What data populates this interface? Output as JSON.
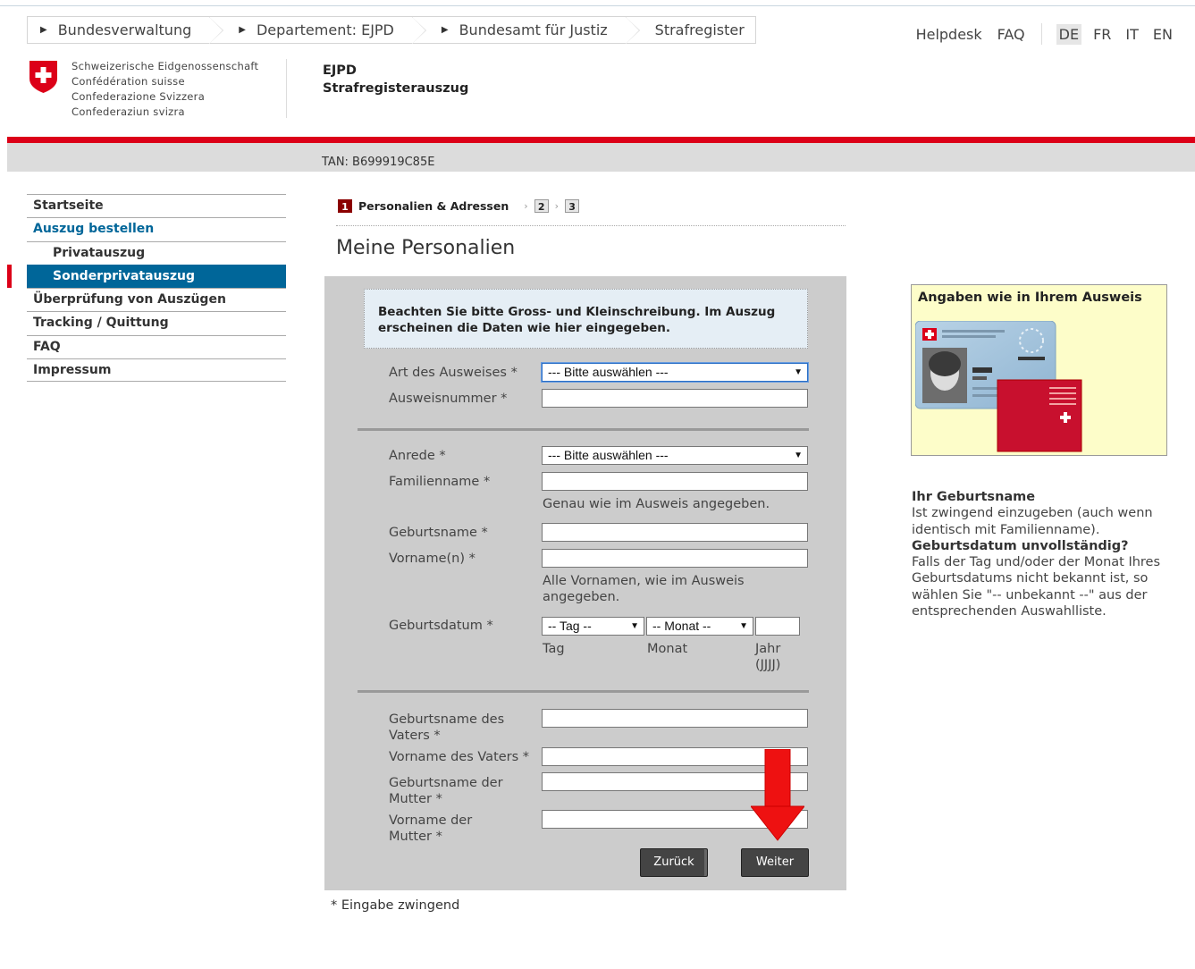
{
  "breadcrumb": [
    {
      "label": "Bundesverwaltung"
    },
    {
      "label": "Departement: EJPD"
    },
    {
      "label": "Bundesamt für Justiz"
    },
    {
      "label": "Strafregister"
    }
  ],
  "toplinks": {
    "helpdesk": "Helpdesk",
    "faq": "FAQ"
  },
  "languages": [
    "DE",
    "FR",
    "IT",
    "EN"
  ],
  "active_language": "DE",
  "confederation": [
    "Schweizerische Eidgenossenschaft",
    "Confédération suisse",
    "Confederazione Svizzera",
    "Confederaziun svizra"
  ],
  "department": {
    "short": "EJPD",
    "title": "Strafregisterauszug"
  },
  "tan": "TAN: B699919C85E",
  "nav": [
    {
      "label": "Startseite"
    },
    {
      "label": "Auszug bestellen"
    },
    {
      "label": "Privatauszug"
    },
    {
      "label": "Sonderprivatauszug"
    },
    {
      "label": "Überprüfung von Auszügen"
    },
    {
      "label": "Tracking / Quittung"
    },
    {
      "label": "FAQ"
    },
    {
      "label": "Impressum"
    }
  ],
  "steps": {
    "step1_num": "1",
    "step1_label": "Personalien & Adressen",
    "step2_num": "2",
    "step3_num": "3"
  },
  "page_title": "Meine Personalien",
  "notice": "Beachten Sie bitte Gross- und Kleinschreibung. Im Auszug erscheinen die Daten wie hier eingegeben.",
  "form": {
    "id_type_label": "Art des Ausweises *",
    "id_type_value": "--- Bitte auswählen ---",
    "id_number_label": "Ausweisnummer *",
    "salutation_label": "Anrede *",
    "salutation_value": "--- Bitte auswählen ---",
    "family_name_label": "Familienname *",
    "family_name_hint": "Genau wie im Ausweis angegeben.",
    "birth_name_label": "Geburtsname *",
    "first_names_label": "Vorname(n) *",
    "first_names_hint": "Alle Vornamen, wie im Ausweis angegeben.",
    "birthdate_label": "Geburtsdatum  *",
    "day_value": "-- Tag --",
    "month_value": "-- Monat --",
    "day_hint": "Tag",
    "month_hint": "Monat",
    "year_hint": "Jahr (JJJJ)",
    "father_birth_name_label": "Geburtsname des Vaters *",
    "father_first_name_label": "Vorname des Vaters *",
    "mother_birth_name_label": "Geburtsname der Mutter *",
    "mother_first_name_label": "Vorname der Mutter *",
    "back_label": "Zurück",
    "next_label": "Weiter"
  },
  "required_note": "* Eingabe zwingend",
  "id_box_title": "Angaben wie in Ihrem Ausweis",
  "side_help": {
    "h1": "Ihr Geburtsname",
    "p1": "Ist zwingend einzugeben (auch wenn identisch mit Familienname).",
    "h2": "Geburtsdatum unvollständig?",
    "p2": "Falls der Tag und/oder der Monat Ihres Geburtsdatums nicht bekannt ist, so wählen Sie \"-- unbekannt --\" aus der entsprechenden Auswahlliste."
  },
  "colors": {
    "swiss_red": "#dc0018",
    "nav_blue": "#006699",
    "button_dark": "#444444",
    "arrow_red": "#ee1111"
  }
}
